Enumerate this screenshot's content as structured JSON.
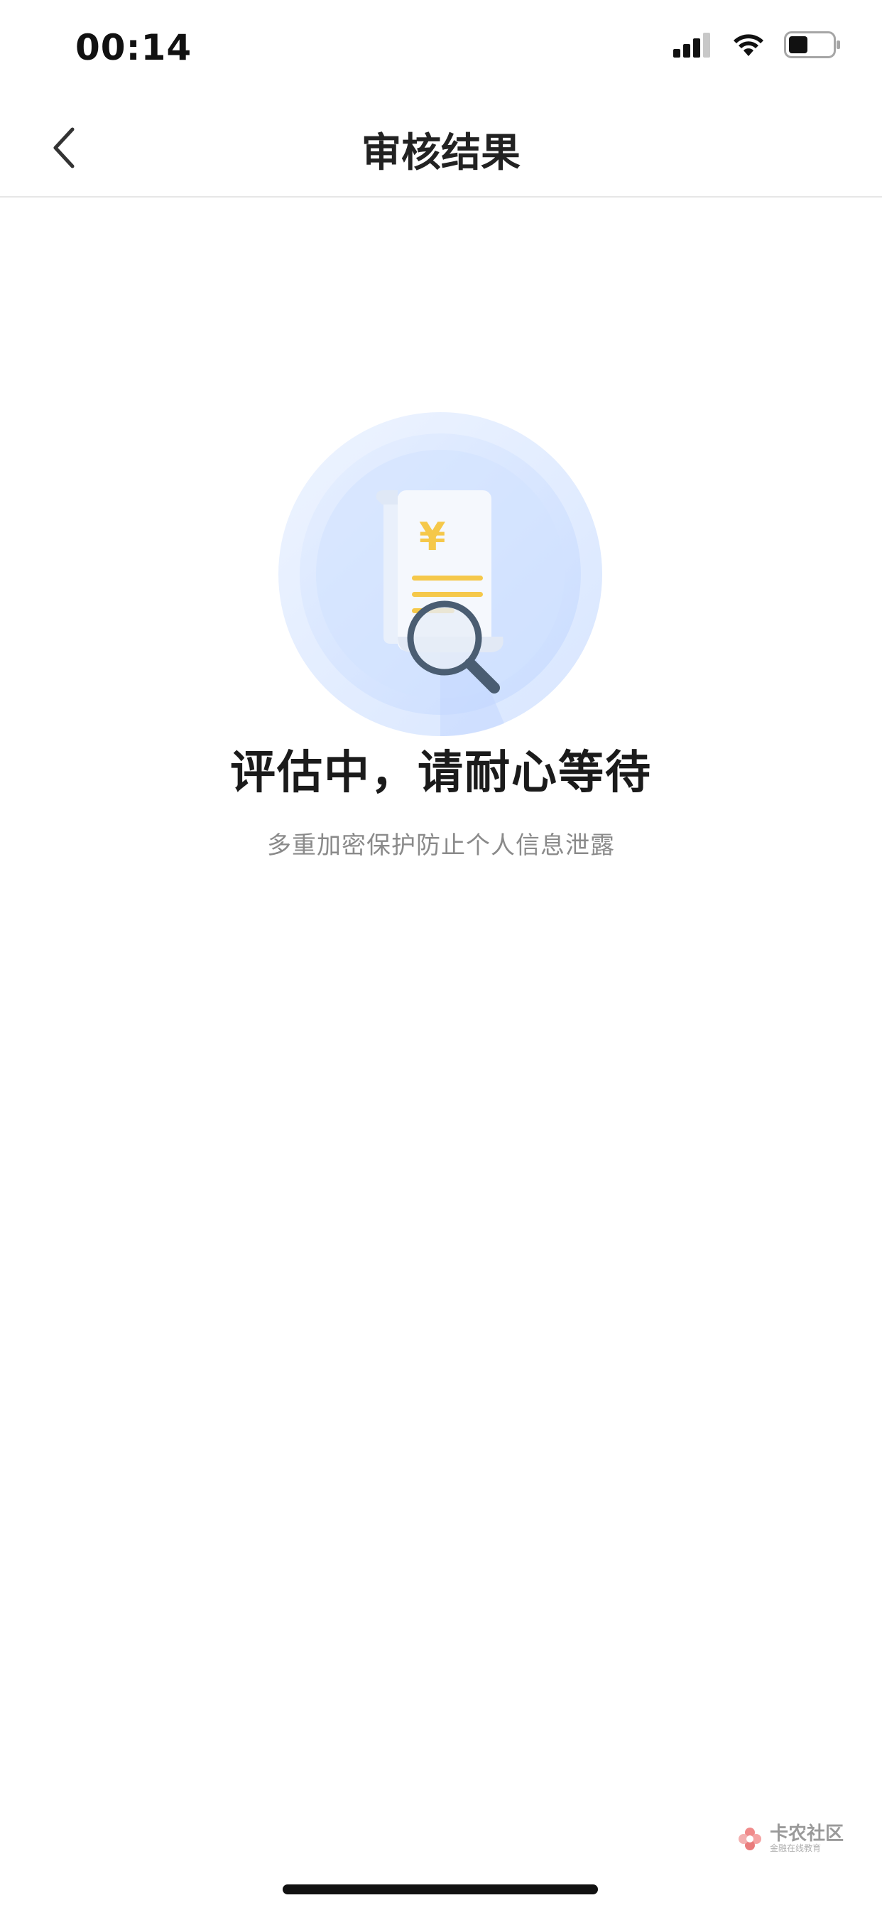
{
  "status_bar": {
    "time": "00:14",
    "icons": [
      "cellular-signal-icon",
      "wifi-icon",
      "battery-icon"
    ]
  },
  "header": {
    "back_icon": "chevron-left-icon",
    "title": "审核结果"
  },
  "illustration": {
    "icon": "receipt-magnifier-icon",
    "currency_symbol": "¥"
  },
  "status": {
    "title": "评估中，请耐心等待",
    "subtitle": "多重加密保护防止个人信息泄露"
  },
  "watermark": {
    "main": "卡农社区",
    "sub": "金融在线教育"
  },
  "colors": {
    "accent_blue": "#c7dcff",
    "yellow_line": "#f5c84a",
    "magnifier": "#4a5d72"
  }
}
